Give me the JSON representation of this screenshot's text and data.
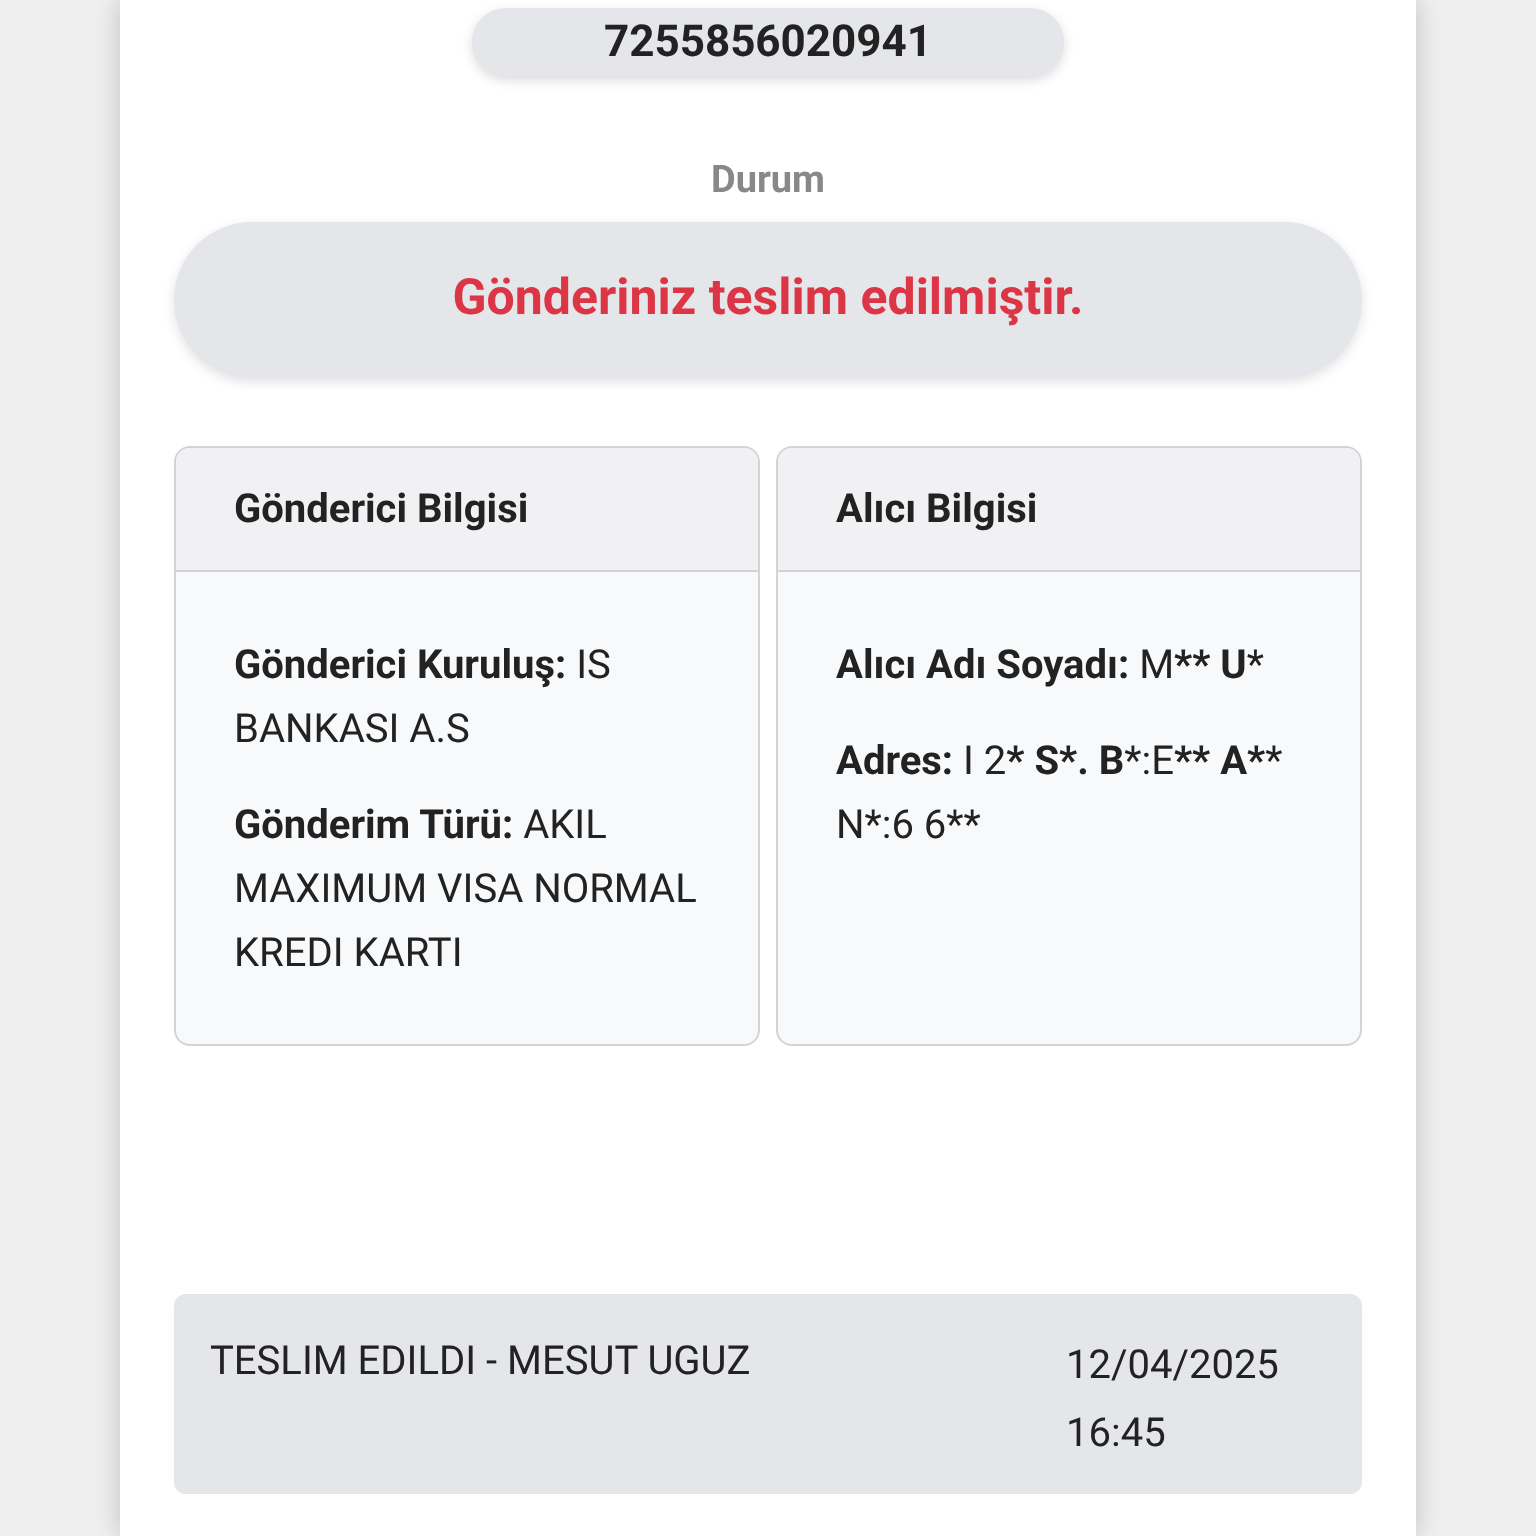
{
  "tracking_number": "7255856020941",
  "status": {
    "label": "Durum",
    "message": "Gönderiniz teslim edilmiştir."
  },
  "cards": [
    {
      "title": "Gönderici Bilgisi",
      "lines": [
        "**Gönderici Kuruluş:** IS BANKASI A.S",
        "**Gönderim Türü:** AKIL MAXIMUM VISA NORMAL KREDI KARTI"
      ]
    },
    {
      "title": "Alıcı Bilgisi",
      "lines": [
        "**Alıcı Adı Soyadı:** M**** U***",
        "**Adres:** I 2*** S*. B***:E**** A******** N*:6 6**"
      ]
    }
  ],
  "history": [
    {
      "event": "TESLIM EDILDI - MESUT UGUZ",
      "date": "12/04/2025",
      "time": "16:45"
    }
  ]
}
